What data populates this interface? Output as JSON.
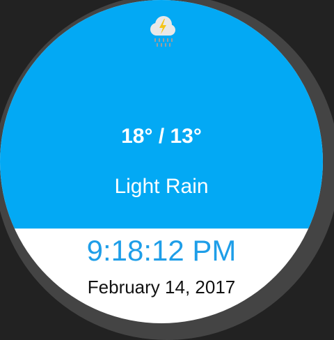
{
  "weather": {
    "icon": "thunderstorm-rain-icon",
    "temps": "18° / 13°",
    "condition": "Light Rain"
  },
  "clock": {
    "time": "9:18:12 PM",
    "date": "February 14, 2017"
  },
  "colors": {
    "sky": "#03a9f4",
    "time_text": "#1e9ee8",
    "bezel": "#444444",
    "background": "#222222"
  }
}
